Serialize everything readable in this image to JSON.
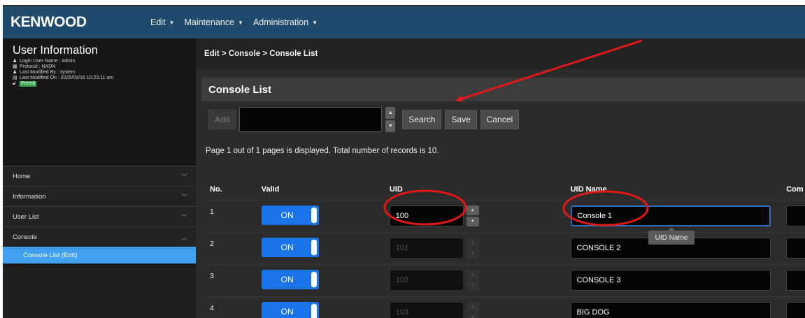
{
  "app": {
    "logo": "KENWOOD"
  },
  "menu": [
    {
      "label": "Edit"
    },
    {
      "label": "Maintenance"
    },
    {
      "label": "Administration"
    }
  ],
  "user_info": {
    "title": "User Information",
    "login_user": "Login User Name : admin",
    "protocol": "Protocol : NXDN",
    "last_modified_by": "Last Modified By : system",
    "last_modified_on": "Last Modified On : 2025/09/16 10:23:11 am",
    "permit": "Permit"
  },
  "sidebar": {
    "items": [
      {
        "label": "Home"
      },
      {
        "label": "Information"
      },
      {
        "label": "User List"
      },
      {
        "label": "Console"
      }
    ],
    "sub_item": "Console List (Edit)"
  },
  "breadcrumb": "Edit  >  Console  >  Console List",
  "panel_title": "Console List",
  "toolbar": {
    "add_label": "Add",
    "search_value": "",
    "search_label": "Search",
    "save_label": "Save",
    "cancel_label": "Cancel"
  },
  "status_text": "Page 1 out of 1 pages is displayed. Total number of records is 10.",
  "table": {
    "headers": {
      "no": "No.",
      "valid": "Valid",
      "uid": "UID",
      "uid_name": "UID Name",
      "com": "Com"
    },
    "rows": [
      {
        "no": "1",
        "valid": "ON",
        "uid": "100",
        "uid_name": "Console 1"
      },
      {
        "no": "2",
        "valid": "ON",
        "uid": "101",
        "uid_name": "CONSOLE 2"
      },
      {
        "no": "3",
        "valid": "ON",
        "uid": "102",
        "uid_name": "CONSOLE 3"
      },
      {
        "no": "4",
        "valid": "ON",
        "uid": "103",
        "uid_name": "BIG DOG"
      }
    ]
  },
  "tooltip": "UID Name",
  "colors": {
    "topbar": "#1f4a6b",
    "accent_blue": "#1a73e8",
    "active_nav": "#3fa0f0",
    "annotation_red": "#e01818"
  },
  "icons": {
    "caret": "caret-down-icon",
    "nav_chevron": "chevron-down-icon",
    "spinner": "spinner-arrows-icon"
  }
}
